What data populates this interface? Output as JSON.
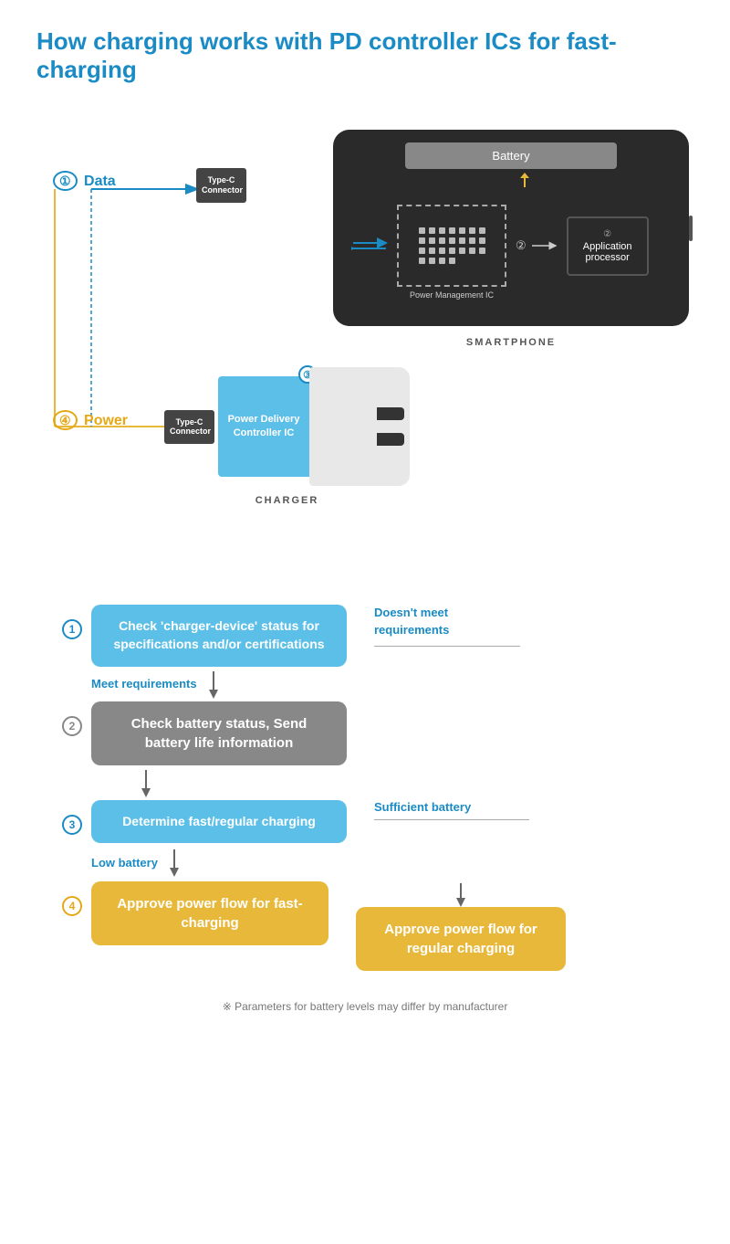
{
  "title": "How charging works with PD controller ICs for fast-charging",
  "diagram": {
    "smartphone_label": "SMARTPHONE",
    "battery_label": "Battery",
    "pmic_label": "Power Management IC",
    "ap_label": "Application\nprocessor",
    "typec_label": "Type-C\nConnector",
    "typec_charger_label": "Type-C\nConnector",
    "data_label": "Data",
    "power_label": "Power",
    "charger_label": "CHARGER",
    "pd_ic_label": "Power\nDelivery\nController\nIC",
    "step1_circle": "①",
    "step2_circle": "②",
    "step3_circle": "③",
    "step4_circle": "④"
  },
  "flowchart": {
    "step1_num": "①",
    "step1_text": "Check 'charger-device' status for specifications and/or certifications",
    "step1_meet": "Meet requirements",
    "step1_doesnt_meet": "Doesn't meet\nrequirements",
    "step2_num": "②",
    "step2_text": "Check battery status, Send battery life information",
    "step3_num": "③",
    "step3_text": "Determine fast/regular\ncharging",
    "step3_sufficient": "Sufficient battery",
    "step3_low": "Low battery",
    "step4_num": "④",
    "step4a_text": "Approve power flow\nfor fast-charging",
    "step4b_text": "Approve power flow\nfor regular charging",
    "footnote": "※  Parameters for battery levels may differ by manufacturer"
  },
  "colors": {
    "blue": "#1a8bc4",
    "light_blue": "#5bbfe8",
    "yellow": "#e8b83a",
    "gray": "#888888",
    "dark": "#2a2a2a"
  }
}
